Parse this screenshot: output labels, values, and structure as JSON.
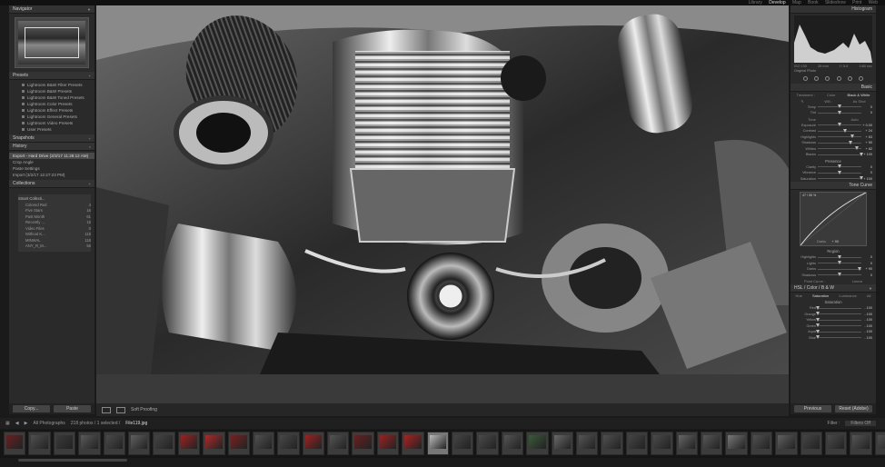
{
  "topbar": {
    "modules": [
      "Library",
      "Develop",
      "Map",
      "Book",
      "Slideshow",
      "Print",
      "Web"
    ],
    "active_module": "Develop"
  },
  "left_panel": {
    "navigator_title": "Navigator",
    "presets_title": "Presets",
    "presets": [
      "Lightroom B&W Filter Presets",
      "Lightroom B&W Presets",
      "Lightroom B&W Toned Presets",
      "Lightroom Color Presets",
      "Lightroom Effect Presets",
      "Lightroom General Presets",
      "Lightroom Video Presets",
      "User Presets"
    ],
    "snapshots_title": "Snapshots",
    "history_title": "History",
    "history": [
      "Export - Hard Drive (3/3/17 11:28:12 AM)",
      "Crop Angle",
      "Paste Settings",
      "Import (3/2/17 12:27:23 PM)"
    ],
    "collections_title": "Collections",
    "collections": [
      {
        "name": "Smart Collecti...",
        "count": ""
      },
      {
        "name": "Colored Red",
        "count": "4"
      },
      {
        "name": "Five Stars",
        "count": "16"
      },
      {
        "name": "Past Month",
        "count": "61"
      },
      {
        "name": "Recently ...",
        "count": "15"
      },
      {
        "name": "Video Files",
        "count": "0"
      },
      {
        "name": "Without K...",
        "count": "118"
      },
      {
        "name": "MINWAL",
        "count": "118"
      },
      {
        "name": "ANY_R_M...",
        "count": "56"
      }
    ],
    "copy_button": "Copy...",
    "paste_button": "Paste"
  },
  "toolbar": {
    "soft_proofing": "Soft Proofing"
  },
  "right_panel": {
    "histogram_title": "Histogram",
    "histogram_meta": [
      "ISO 100",
      "28 mm",
      "f / 5.6",
      "1/80 sec"
    ],
    "original_photo": "Original Photo",
    "basic_title": "Basic",
    "treatment_label": "Treatment :",
    "treatment_color": "Color",
    "treatment_bw": "Black & White",
    "wb_label": "WB :",
    "wb_value": "As Shot",
    "tone_label": "Tone",
    "tone_auto": "Auto",
    "presence_label": "Presence",
    "basic_sliders": [
      {
        "label": "Temp",
        "value": "0",
        "pos": 0.5
      },
      {
        "label": "Tint",
        "value": "0",
        "pos": 0.5
      },
      {
        "label": "Exposure",
        "value": "+ 0.00",
        "pos": 0.5
      },
      {
        "label": "Contrast",
        "value": "+ 24",
        "pos": 0.62
      },
      {
        "label": "Highlights",
        "value": "+ 63",
        "pos": 0.8
      },
      {
        "label": "Shadows",
        "value": "+ 50",
        "pos": 0.75
      },
      {
        "label": "Whites",
        "value": "+ 82",
        "pos": 0.9
      },
      {
        "label": "Blacks",
        "value": "+ 100",
        "pos": 1.0
      },
      {
        "label": "Clarity",
        "value": "0",
        "pos": 0.5
      },
      {
        "label": "Vibrance",
        "value": "0",
        "pos": 0.5
      },
      {
        "label": "Saturation",
        "value": "+ 100",
        "pos": 1.0
      }
    ],
    "tone_curve_title": "Tone Curve",
    "curve_readout": "47 / 55 %",
    "curve_slider_label": "Darks",
    "curve_slider_value": "+ 90",
    "region_label": "Region",
    "region_sliders": [
      {
        "label": "Highlights",
        "value": "0",
        "pos": 0.5
      },
      {
        "label": "Lights",
        "value": "0",
        "pos": 0.5
      },
      {
        "label": "Darks",
        "value": "+ 90",
        "pos": 0.95
      },
      {
        "label": "Shadows",
        "value": "0",
        "pos": 0.5
      }
    ],
    "point_curve_label": "Point Curve :",
    "point_curve_value": "Linear",
    "hsl_title": "HSL / Color / B & W",
    "hsl_tabs": [
      "Hue",
      "Saturation",
      "Luminance",
      "All"
    ],
    "hsl_active": "Saturation",
    "saturation_label": "Saturation",
    "hsl_sliders": [
      {
        "label": "Red",
        "value": "- 100",
        "pos": 0.0
      },
      {
        "label": "Orange",
        "value": "- 100",
        "pos": 0.0
      },
      {
        "label": "Yellow",
        "value": "- 100",
        "pos": 0.0
      },
      {
        "label": "Green",
        "value": "- 100",
        "pos": 0.0
      },
      {
        "label": "Aqua",
        "value": "- 100",
        "pos": 0.0
      },
      {
        "label": "Blue",
        "value": "- 100",
        "pos": 0.0
      }
    ],
    "previous_button": "Previous",
    "reset_button": "Reset (Adobe)"
  },
  "filmbar": {
    "source": "All Photographs",
    "count": "218 photos / 1 selected /",
    "file": "File119.jpg",
    "filter_label": "Filter :",
    "filter_value": "Filters Off"
  },
  "filmstrip": {
    "thumb_colors": [
      "#6a2020",
      "#505050",
      "#3a3a3a",
      "#5a5a5a",
      "#4a4a4a",
      "#606060",
      "#444",
      "#a02020",
      "#b02828",
      "#7a2020",
      "#505050",
      "#484848",
      "#a02020",
      "#555",
      "#6a2020",
      "#a02020",
      "#b02020",
      "#bbb",
      "#444",
      "#4a4a4a",
      "#555",
      "#3a5a3a",
      "#6a6a6a",
      "#555",
      "#505050",
      "#444",
      "#4a4a4a",
      "#666",
      "#585858",
      "#777",
      "#505050",
      "#606060",
      "#444",
      "#4a4a4a",
      "#555",
      "#505050",
      "#777"
    ]
  }
}
